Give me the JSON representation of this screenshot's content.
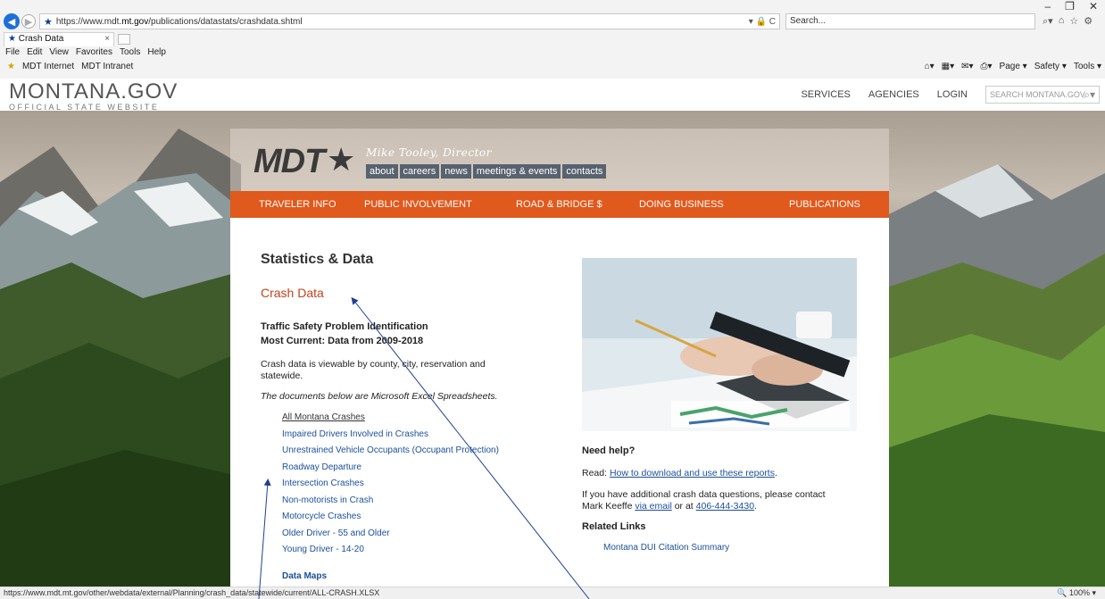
{
  "browser": {
    "url_prefix": "https://www.mdt.",
    "url_host": "mt.gov",
    "url_path": "/publications/datastats/crashdata.shtml",
    "addr_controls": "▾ 🔒 C",
    "search_placeholder": "Search...",
    "tab_title": "Crash Data",
    "menu": [
      "File",
      "Edit",
      "View",
      "Favorites",
      "Tools",
      "Help"
    ],
    "favorites": [
      "MDT Internet",
      "MDT Intranet"
    ],
    "command_bar": [
      "Page ▾",
      "Safety ▾",
      "Tools ▾"
    ],
    "status_url": "https://www.mdt.mt.gov/other/webdata/external/Planning/crash_data/statewide/current/ALL-CRASH.XLSX",
    "zoom": "100%"
  },
  "montana": {
    "logo": "MONTANA.GOV",
    "tagline": "OFFICIAL STATE WEBSITE",
    "nav": [
      "SERVICES",
      "AGENCIES",
      "LOGIN"
    ],
    "search_placeholder": "SEARCH MONTANA.GOV"
  },
  "mdt": {
    "logo": "MDT",
    "director": "Mike Tooley, Director",
    "links": [
      "about",
      "careers",
      "news",
      "meetings & events",
      "contacts"
    ],
    "nav": [
      "TRAVELER INFO",
      "PUBLIC INVOLVEMENT",
      "ROAD & BRIDGE $",
      "DOING BUSINESS",
      "PUBLICATIONS"
    ]
  },
  "content": {
    "title": "Statistics & Data",
    "subtitle": "Crash Data",
    "bold1": "Traffic Safety Problem Identification",
    "bold2": "Most Current: Data from 2009-2018",
    "para1a": "Crash data is viewable by county, city, reservation and",
    "para1b": "statewide.",
    "para2": "The documents below are Microsoft Excel Spreadsheets.",
    "downloads": [
      "All Montana Crashes",
      "Impaired Drivers Involved in Crashes",
      "Unrestrained Vehicle Occupants (Occupant Protection)",
      "Roadway Departure",
      "Intersection Crashes",
      "Non-motorists in Crash",
      "Motorcycle Crashes",
      "Older Driver - 55 and Older",
      "Young Driver - 14-20"
    ],
    "data_maps": "Data Maps",
    "help_title": "Need help?",
    "help_read": "Read: ",
    "help_link": "How to download and use these reports",
    "help_read_end": ".",
    "contact_a": "If you have additional crash data questions, please contact",
    "contact_b": "Mark Keeffe ",
    "contact_link": "via email",
    "contact_c": " or at ",
    "contact_phone": "406-444-3430",
    "contact_end": ".",
    "related_title": "Related Links",
    "related_link": "Montana DUI Citation Summary"
  }
}
